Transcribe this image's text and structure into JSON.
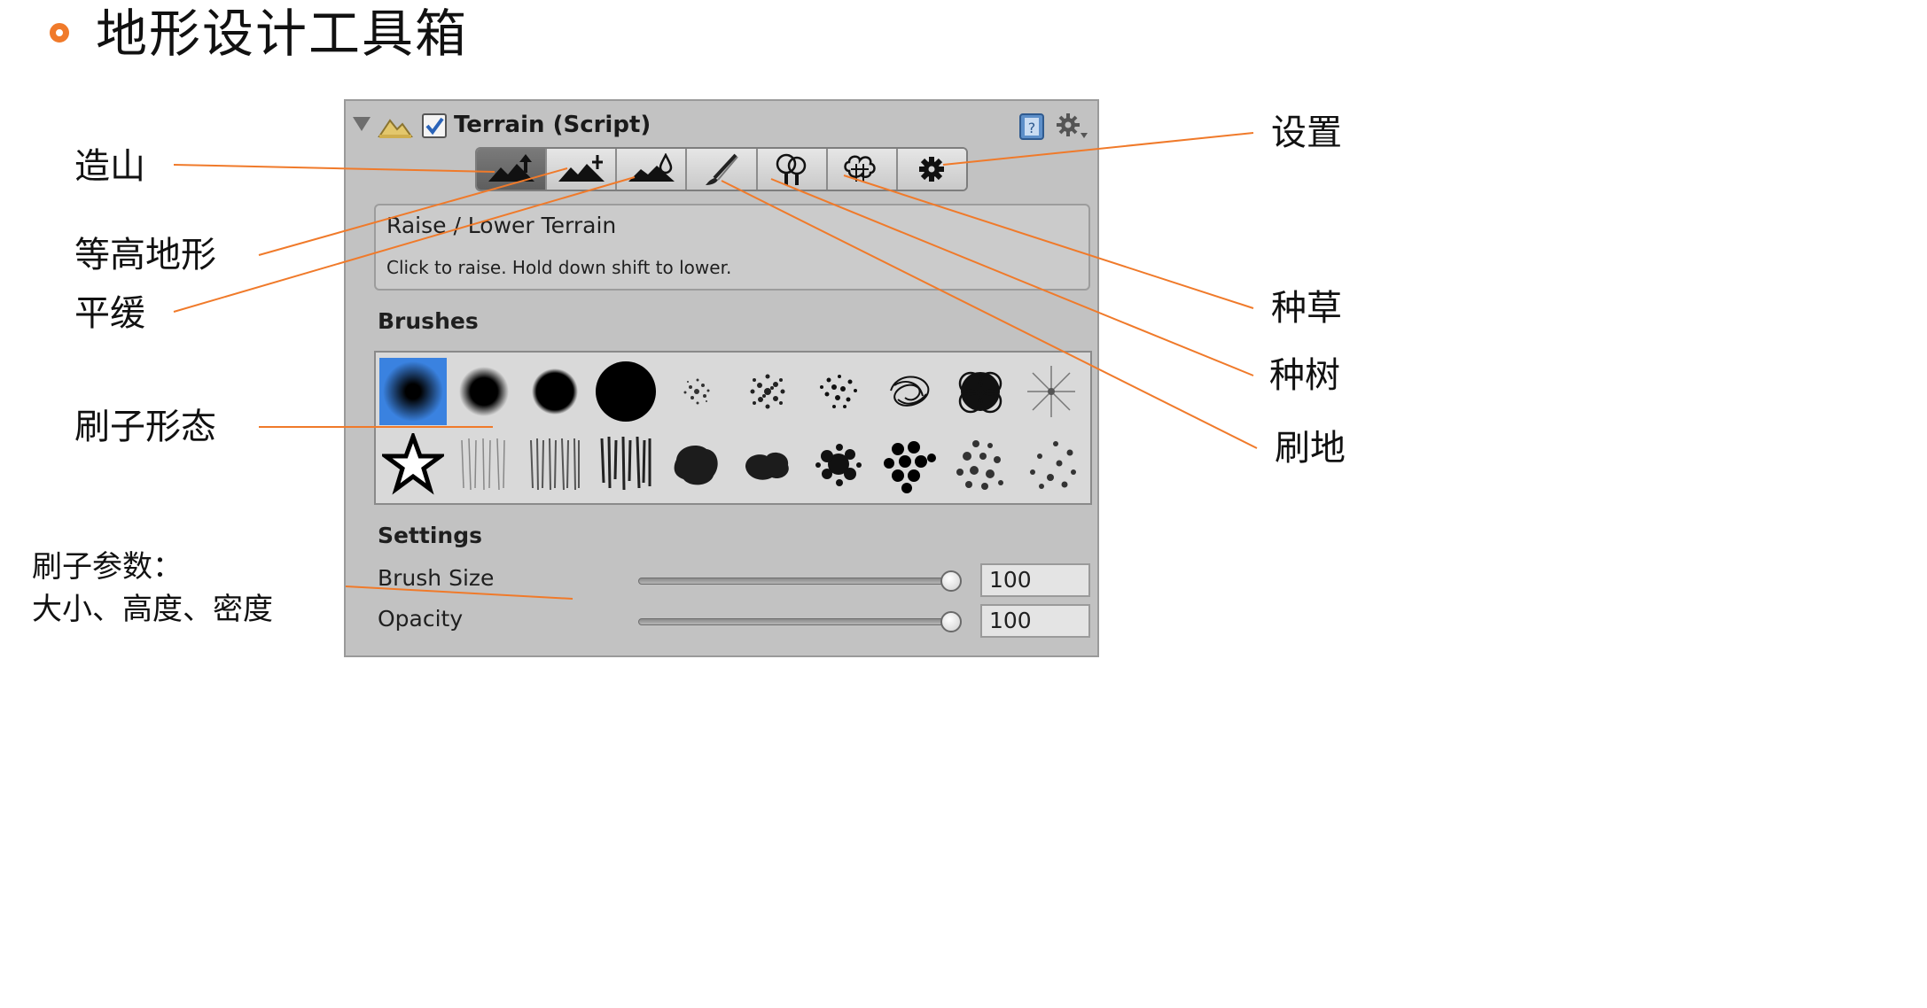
{
  "slide": {
    "title": "地形设计工具箱",
    "accent_color": "#f07a2a"
  },
  "callouts": {
    "raise": "造山",
    "paint_height": "等高地形",
    "smooth": "平缓",
    "brushes": "刷子形态",
    "brush_params_line1": "刷子参数：",
    "brush_params_line2": "大小、高度、密度",
    "settings": "设置",
    "grass": "种草",
    "trees": "种树",
    "paint_texture": "刷地"
  },
  "inspector": {
    "header_title": "Terrain (Script)",
    "enabled": true,
    "tools": [
      {
        "id": "raise-lower",
        "icon": "raise-terrain-icon",
        "active": true
      },
      {
        "id": "paint-height",
        "icon": "paint-height-icon",
        "active": false
      },
      {
        "id": "smooth-height",
        "icon": "smooth-height-icon",
        "active": false
      },
      {
        "id": "paint-texture",
        "icon": "paint-brush-icon",
        "active": false
      },
      {
        "id": "place-trees",
        "icon": "tree-icon",
        "active": false
      },
      {
        "id": "paint-details",
        "icon": "grass-detail-icon",
        "active": false
      },
      {
        "id": "terrain-settings",
        "icon": "gear-icon",
        "active": false
      }
    ],
    "tool_info": {
      "title": "Raise / Lower Terrain",
      "description": "Click to raise. Hold down shift to lower."
    },
    "brushes_title": "Brushes",
    "selected_brush": 0,
    "settings_title": "Settings",
    "brush_size_label": "Brush Size",
    "brush_size_value": "100",
    "brush_size_fraction": 1.0,
    "opacity_label": "Opacity",
    "opacity_value": "100",
    "opacity_fraction": 1.0
  }
}
